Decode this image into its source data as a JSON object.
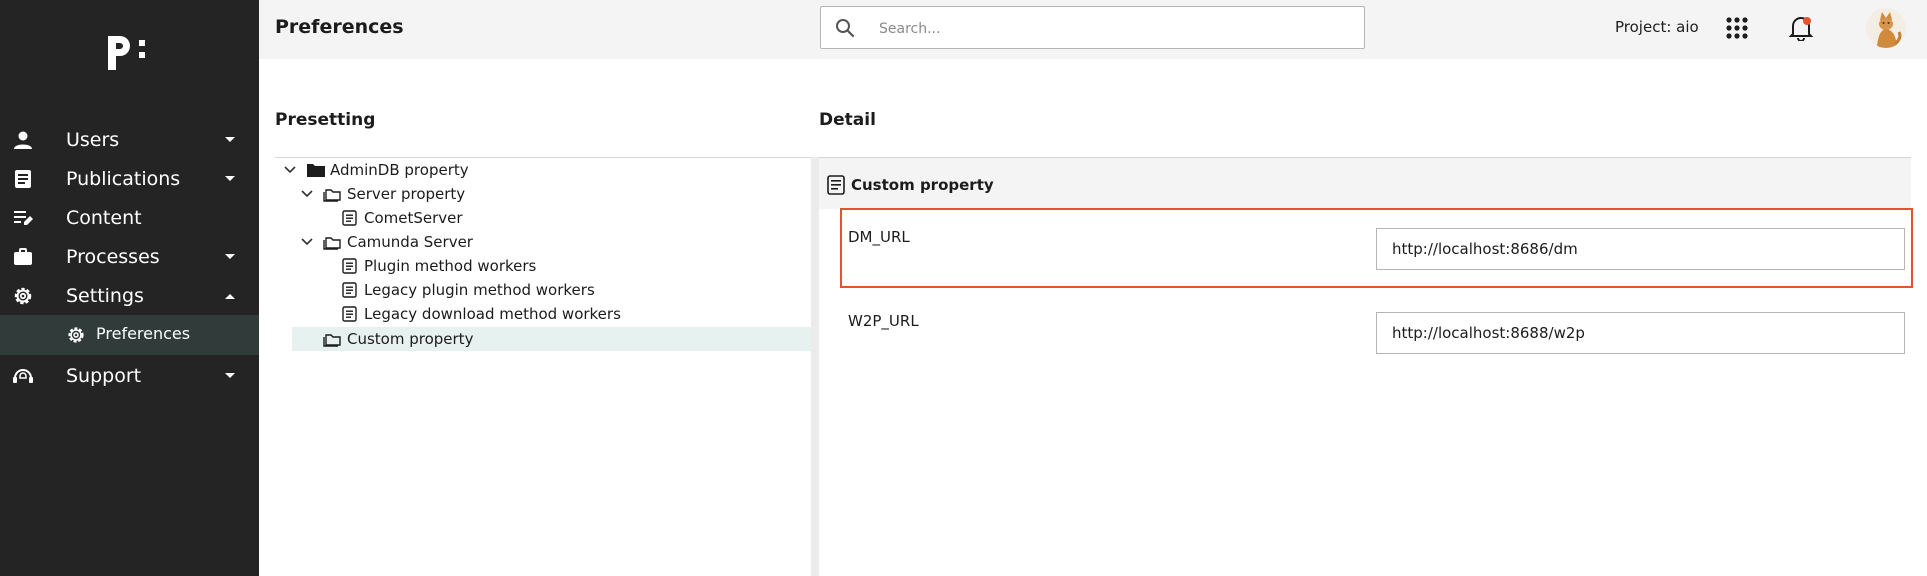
{
  "sidebar": {
    "logo_text": "p:",
    "items": [
      {
        "label": "Users",
        "icon": "user-icon",
        "expanded": false
      },
      {
        "label": "Publications",
        "icon": "document-icon",
        "expanded": false
      },
      {
        "label": "Content",
        "icon": "edit-list-icon"
      },
      {
        "label": "Processes",
        "icon": "briefcase-icon",
        "expanded": false
      },
      {
        "label": "Settings",
        "icon": "gear-icon",
        "expanded": true
      },
      {
        "label": "Support",
        "icon": "headset-icon",
        "expanded": false
      }
    ],
    "sub_item": {
      "label": "Preferences",
      "icon": "gear-icon",
      "selected": true
    }
  },
  "header": {
    "title": "Preferences",
    "search_placeholder": "Search...",
    "project": "Project: aio",
    "notification_badge_color": "#e8502e"
  },
  "presetting": {
    "title": "Presetting",
    "tree": [
      {
        "label": "AdminDB property",
        "type": "folder-filled",
        "level": 0,
        "expanded": true
      },
      {
        "label": "Server property",
        "type": "folder-open",
        "level": 1,
        "expanded": true
      },
      {
        "label": "CometServer",
        "type": "document",
        "level": 2
      },
      {
        "label": "Camunda Server",
        "type": "folder-open",
        "level": 1,
        "expanded": true
      },
      {
        "label": "Plugin method workers",
        "type": "document",
        "level": 2
      },
      {
        "label": "Legacy plugin method workers",
        "type": "document",
        "level": 2
      },
      {
        "label": "Legacy download method workers",
        "type": "document",
        "level": 2
      },
      {
        "label": "Custom property",
        "type": "folder-open",
        "level": 1,
        "selected": true
      }
    ]
  },
  "detail": {
    "title": "Detail",
    "header_label": "Custom property",
    "properties": [
      {
        "label": "DM_URL",
        "value": "http://localhost:8686/dm",
        "highlighted": true
      },
      {
        "label": "W2P_URL",
        "value": "http://localhost:8688/w2p",
        "highlighted": false
      }
    ],
    "highlight_color": "#e8502e"
  }
}
